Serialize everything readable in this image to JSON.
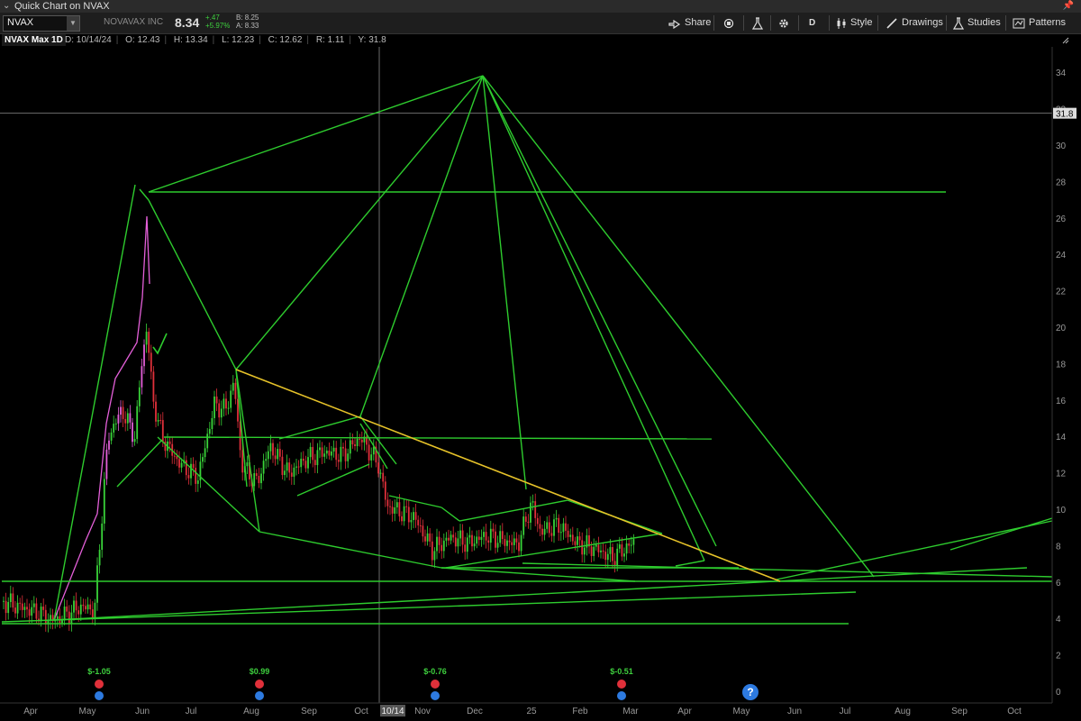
{
  "window": {
    "title": "Quick Chart on NVAX"
  },
  "toolbar": {
    "symbol": "NVAX",
    "company": "NOVAVAX INC",
    "last": "8.34",
    "change": "+.47",
    "change_pct": "+5.97%",
    "bid": "B: 8.25",
    "ask": "A: 8.33",
    "share_label": "Share",
    "aggregation_label": "D",
    "style_label": "Style",
    "drawings_label": "Drawings",
    "studies_label": "Studies",
    "patterns_label": "Patterns"
  },
  "header": {
    "study_name": "NVAX Max 1D",
    "date": "D: 10/14/24",
    "open": "O: 12.43",
    "high": "H: 13.34",
    "low": "L: 12.23",
    "close": "C: 12.62",
    "range": "R: 1.11",
    "y": "Y: 31.8"
  },
  "chart_data": {
    "type": "candlestick",
    "y_axis_labels": [
      "0",
      "2",
      "4",
      "6",
      "8",
      "10",
      "12",
      "14",
      "16",
      "18",
      "20",
      "22",
      "24",
      "26",
      "28",
      "30",
      "32",
      "34"
    ],
    "ylim": [
      0,
      34.5
    ],
    "x_axis_labels": [
      "Apr",
      "May",
      "Jun",
      "Jul",
      "Aug",
      "Sep",
      "Oct",
      "10/14",
      "Nov",
      "Dec",
      "25",
      "Feb",
      "Mar",
      "Apr",
      "May",
      "Jun",
      "Jul",
      "Aug",
      "Sep",
      "Oct"
    ],
    "cursor_date": "10/14",
    "cursor_price": "31.8",
    "earnings": [
      "$-1.05",
      "$0.99",
      "$-0.76",
      "$-0.51"
    ],
    "colors": {
      "up": "#39d339",
      "down": "#e0303a",
      "drawing": "#2ecc2e",
      "trend": "#e6c229",
      "pink": "#e35fd8"
    }
  }
}
